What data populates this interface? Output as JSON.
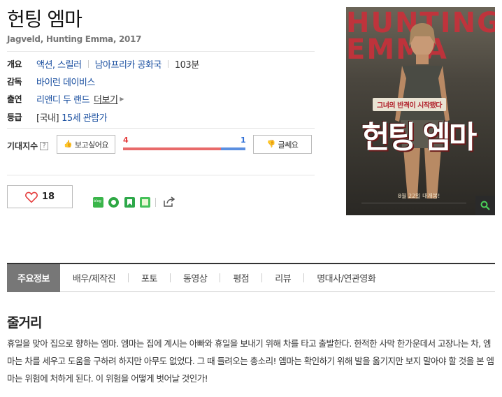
{
  "movie": {
    "title": "헌팅 엠마",
    "subtitle": "Jagveld, Hunting Emma, 2017"
  },
  "info": {
    "overview": {
      "label": "개요",
      "genre": "액션, 스릴러",
      "country": "남아프리카 공화국",
      "runtime": "103분"
    },
    "director": {
      "label": "감독",
      "value": "바이런 데이비스"
    },
    "cast": {
      "label": "출연",
      "value": "리앤디 두 랜드",
      "more": "더보기"
    },
    "rating": {
      "label": "등급",
      "region": "[국내]",
      "value": "15세 관람가"
    }
  },
  "expectation": {
    "label": "기대지수",
    "help": "?",
    "want_label": "보고싶어요",
    "no_label": "글쎄요",
    "up_count": "4",
    "down_count": "1",
    "up_fraction": 0.8
  },
  "like": {
    "count": "18"
  },
  "share": {
    "icons": [
      {
        "name": "blog-share-icon",
        "color": "#3ab54a",
        "text": "blog"
      },
      {
        "name": "kakaostory-share-icon",
        "color": "#34b048",
        "text": ""
      },
      {
        "name": "bookmark-share-icon",
        "color": "#2ea84a",
        "text": ""
      },
      {
        "name": "memo-share-icon",
        "color": "#45c15a",
        "text": ""
      }
    ]
  },
  "poster": {
    "bg_text": "HUNTING EMMA",
    "tagline": "그녀의 반격이 시작됐다",
    "title": "헌팅 엠마",
    "date": "8월 22일 대개봉!"
  },
  "tabs": [
    "주요정보",
    "배우/제작진",
    "포토",
    "동영상",
    "평점",
    "리뷰",
    "명대사/연관영화"
  ],
  "synopsis": {
    "heading": "줄거리",
    "text": "휴일을 맞아 집으로 향하는 엠마. 엠마는 집에 계시는 아빠와 휴일을 보내기 위해 차를 타고 출발한다. 한적한 사막 한가운데서 고장나는 차, 엠마는 차를 세우고 도움을 구하려 하지만 아무도 없었다. 그 때 들려오는 총소리! 엠마는 확인하기 위해 발을 옮기지만 보지 말아야 할 것을 본 엠마는 위험에 처하게 된다. 이 위험을 어떻게 벗어날 것인가!"
  }
}
